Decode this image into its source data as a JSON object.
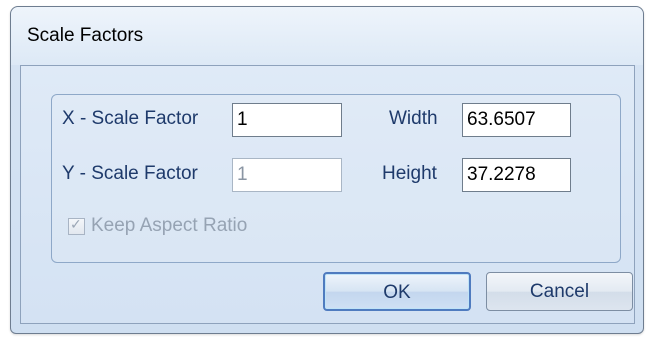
{
  "window": {
    "title": "Scale Factors"
  },
  "fields": {
    "x_scale_label": "X - Scale Factor",
    "x_scale_value": "1",
    "y_scale_label": "Y - Scale Factor",
    "y_scale_value": "1",
    "width_label": "Width",
    "width_value": "63.6507",
    "height_label": "Height",
    "height_value": "37.2278"
  },
  "options": {
    "keep_aspect_ratio_label": "Keep Aspect Ratio",
    "keep_aspect_ratio_checked": true,
    "keep_aspect_ratio_enabled": false
  },
  "buttons": {
    "ok_label": "OK",
    "cancel_label": "Cancel"
  },
  "colors": {
    "label_text": "#1e3a6b",
    "disabled_text": "#96a3b3",
    "default_button_border": "#4f7bbf"
  }
}
